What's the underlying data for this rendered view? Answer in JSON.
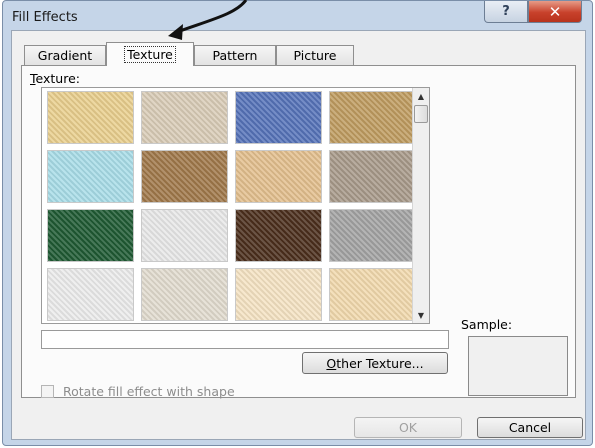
{
  "window": {
    "title": "Fill Effects",
    "help_symbol": "?",
    "close_symbol": "✕"
  },
  "tabs": [
    {
      "label": "Gradient",
      "active": false
    },
    {
      "label": "Texture",
      "active": true
    },
    {
      "label": "Pattern",
      "active": false
    },
    {
      "label": "Picture",
      "active": false
    }
  ],
  "texture_section": {
    "label_accel": "T",
    "label_rest": "exture:",
    "scroll_up_symbol": "▲",
    "scroll_down_symbol": "▼",
    "textures": [
      {
        "name": "papyrus",
        "color": "#e9cf8e"
      },
      {
        "name": "canvas",
        "color": "#d9ccb7"
      },
      {
        "name": "denim",
        "color": "#5673b9"
      },
      {
        "name": "woven-mat",
        "color": "#bf9c60"
      },
      {
        "name": "water-droplets",
        "color": "#a9dde8"
      },
      {
        "name": "paper-bag",
        "color": "#a0784a"
      },
      {
        "name": "fish-fossil",
        "color": "#e3bf8e"
      },
      {
        "name": "sand",
        "color": "#a89a8a"
      },
      {
        "name": "green-marble",
        "color": "#1f5a33"
      },
      {
        "name": "white-marble",
        "color": "#e8e8e8"
      },
      {
        "name": "brown-marble",
        "color": "#4b2e1c"
      },
      {
        "name": "granite",
        "color": "#a3a3a3"
      },
      {
        "name": "newsprint",
        "color": "#ececec"
      },
      {
        "name": "recycled-paper",
        "color": "#e2dccf"
      },
      {
        "name": "parchment",
        "color": "#f5e3c3"
      },
      {
        "name": "stationery",
        "color": "#f2d9ad"
      }
    ]
  },
  "texture_name_value": "",
  "other_texture_button": {
    "accel": "O",
    "rest": "ther Texture..."
  },
  "sample_label": "Sample:",
  "rotate_checkbox": {
    "label": "Rotate fill effect with shape",
    "checked": false,
    "enabled": false
  },
  "ok_button": "OK",
  "cancel_button": "Cancel"
}
